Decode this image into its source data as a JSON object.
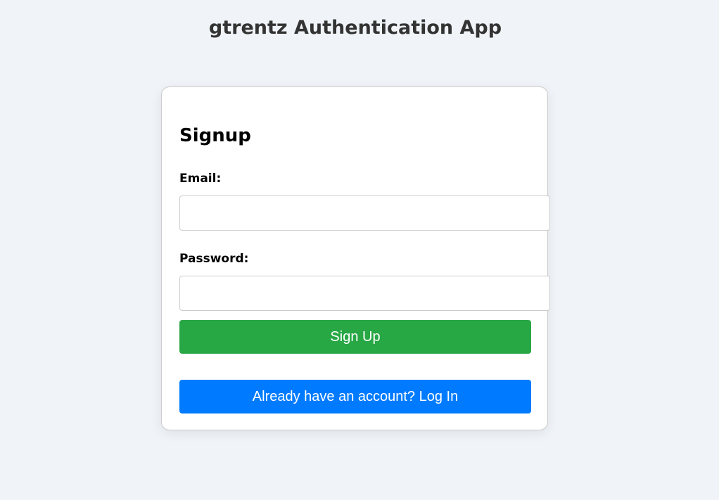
{
  "app_title": "gtrentz Authentication App",
  "form": {
    "heading": "Signup",
    "email_label": "Email:",
    "email_value": "",
    "password_label": "Password:",
    "password_value": "",
    "signup_label": "Sign Up",
    "login_label": "Already have an account? Log In"
  },
  "colors": {
    "signup": "#28a745",
    "login": "#007bff"
  }
}
